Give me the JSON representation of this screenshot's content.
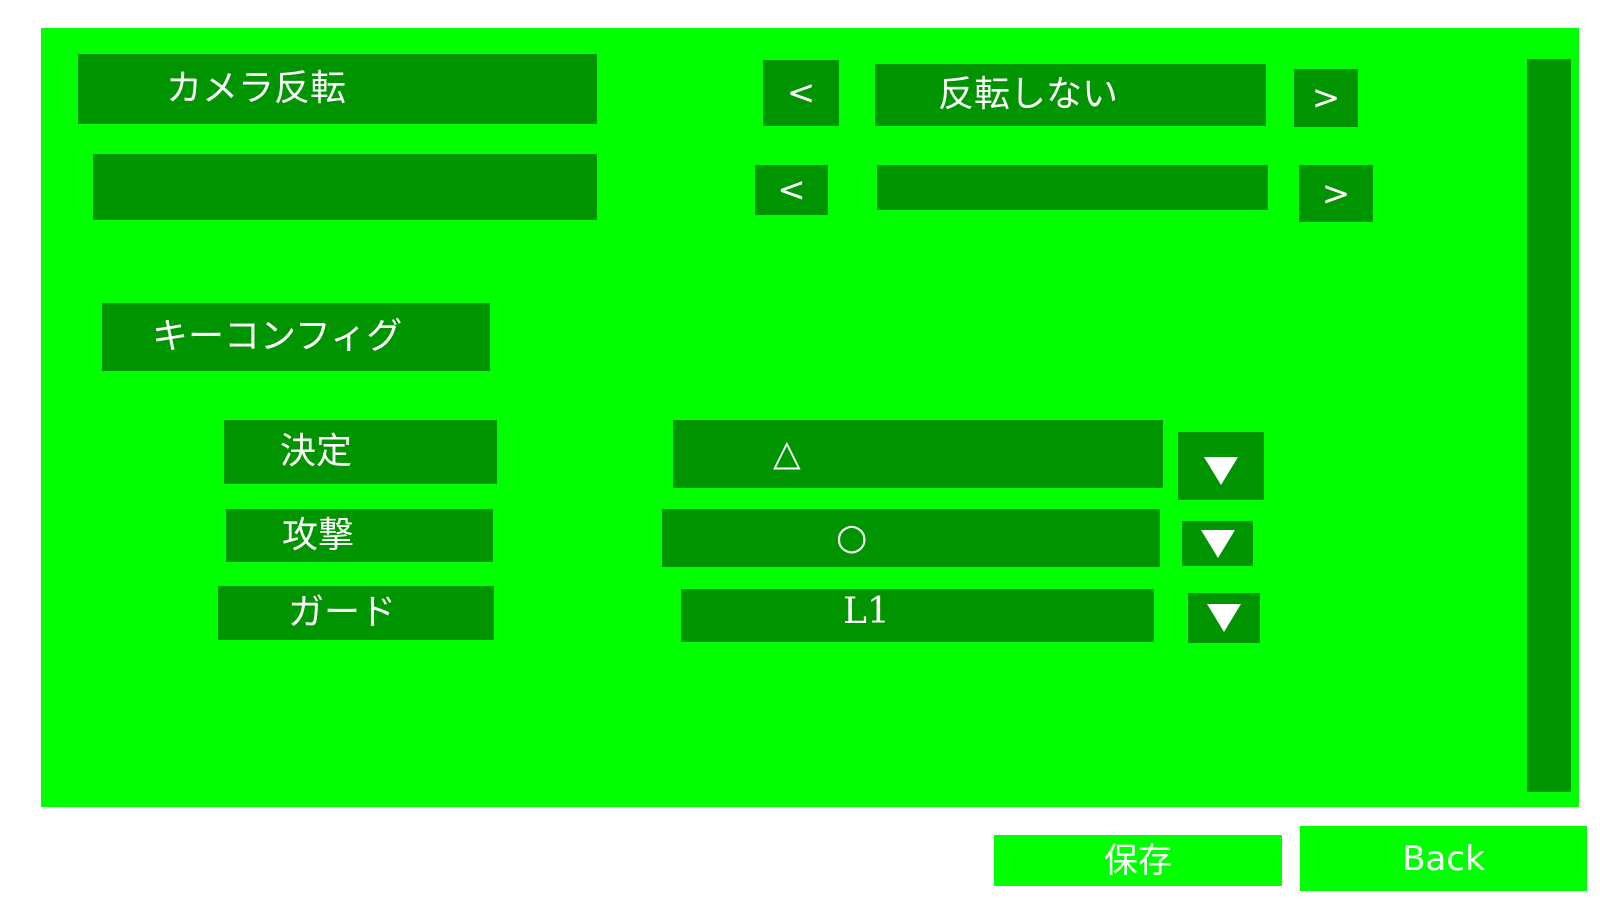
{
  "camera": {
    "label": "カメラ反転",
    "value": "反転しない",
    "prev_symbol": "<",
    "next_symbol": ">"
  },
  "second_setting": {
    "label": "",
    "value": "",
    "prev_symbol": "<",
    "next_symbol": ">"
  },
  "key_config": {
    "heading": "キーコンフィグ",
    "rows": [
      {
        "label": "決定",
        "value": "△"
      },
      {
        "label": "攻撃",
        "value": "○"
      },
      {
        "label": "ガード",
        "value": "L1"
      }
    ]
  },
  "footer": {
    "save_label": "保存",
    "back_label": "Back"
  },
  "colors": {
    "panel": "#00ff00",
    "box": "#009400",
    "text": "#ffffff"
  }
}
